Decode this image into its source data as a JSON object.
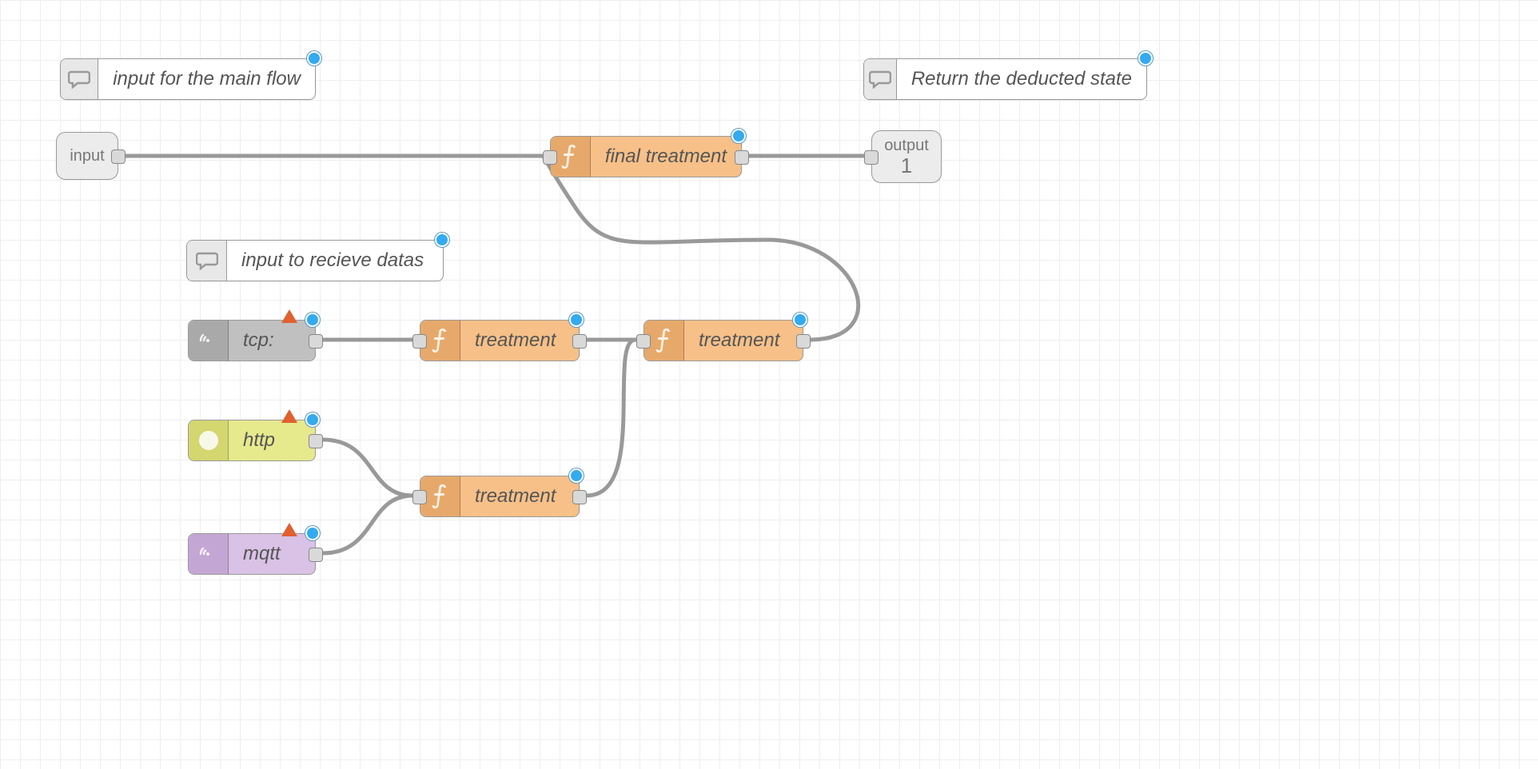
{
  "comments": {
    "main_input": "input for the main flow",
    "return_state": "Return the deducted state",
    "recv_data": "input to recieve datas"
  },
  "subports": {
    "input": {
      "label": "input"
    },
    "output": {
      "label": "output",
      "index": "1"
    }
  },
  "nodes": {
    "final_treatment": "final treatment",
    "tcp": "tcp:",
    "treatment1": "treatment",
    "treatment2": "treatment",
    "http": "http",
    "treatment3": "treatment",
    "mqtt": "mqtt"
  },
  "colors": {
    "wire": "#999999",
    "status_dot": "#34aaf0",
    "warning": "#e06030",
    "function_bg": "#f6c088",
    "http_bg": "#e6e98c",
    "mqtt_bg": "#d9c2e5",
    "tcp_bg": "#c0c0c0"
  }
}
